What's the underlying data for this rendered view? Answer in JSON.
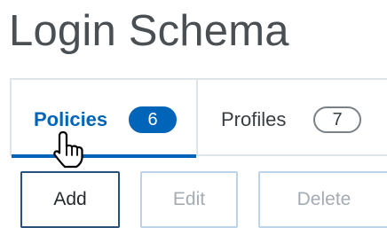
{
  "page": {
    "title": "Login Schema"
  },
  "tabs": [
    {
      "label": "Policies",
      "count": "6",
      "active": true
    },
    {
      "label": "Profiles",
      "count": "7",
      "active": false
    }
  ],
  "toolbar": {
    "add_label": "Add",
    "edit_label": "Edit",
    "delete_label": "Delete"
  },
  "cursor": {
    "icon": "hand-pointer-icon"
  },
  "colors": {
    "accent": "#0064b9",
    "title": "#4a4f54",
    "disabled_text": "#a4acb3",
    "disabled_border": "#bcd3e9"
  }
}
